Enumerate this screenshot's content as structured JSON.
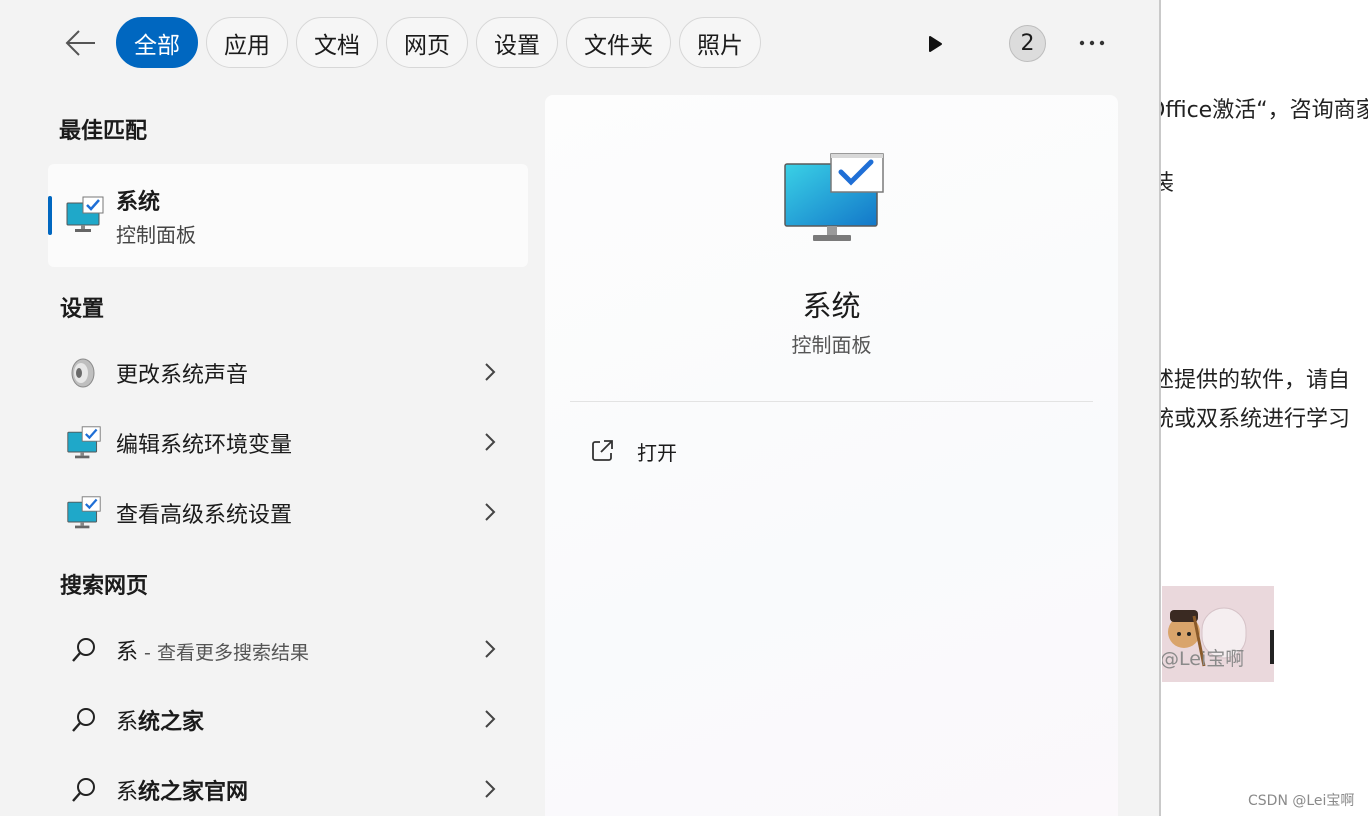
{
  "toolbar": {
    "tabs": [
      {
        "label": "全部",
        "active": true
      },
      {
        "label": "应用",
        "active": false
      },
      {
        "label": "文档",
        "active": false
      },
      {
        "label": "网页",
        "active": false
      },
      {
        "label": "设置",
        "active": false
      },
      {
        "label": "文件夹",
        "active": false
      },
      {
        "label": "照片",
        "active": false
      }
    ],
    "badge_count": "2",
    "icons": [
      "back-arrow-icon",
      "play-icon",
      "more-dots-icon"
    ]
  },
  "best_match": {
    "section": "最佳匹配",
    "title": "系统",
    "subtitle": "控制面板"
  },
  "settings": {
    "section": "设置",
    "items": [
      {
        "label": "更改系统声音",
        "icon": "speaker-icon"
      },
      {
        "label": "编辑系统环境变量",
        "icon": "monitor-check-icon"
      },
      {
        "label": "查看高级系统设置",
        "icon": "monitor-check-icon"
      }
    ]
  },
  "web": {
    "section": "搜索网页",
    "items": [
      {
        "prefix": "系",
        "suffix": " - 查看更多搜索结果"
      },
      {
        "prefix": "系",
        "bold": "统之家"
      },
      {
        "prefix": "系",
        "bold": "统之家官网"
      }
    ]
  },
  "detail": {
    "title": "系统",
    "subtitle": "控制面板",
    "open_label": "打开"
  },
  "background_page": {
    "line1": "Office激活“，咨询商家",
    "line2": "装",
    "line3": "述提供的软件，请自",
    "line4": "统或双系统进行学习",
    "image_caption": "@Lei宝啊",
    "watermark": "CSDN @Lei宝啊"
  },
  "colors": {
    "accent": "#0067c0",
    "panel_bg": "#f3f3f3"
  }
}
